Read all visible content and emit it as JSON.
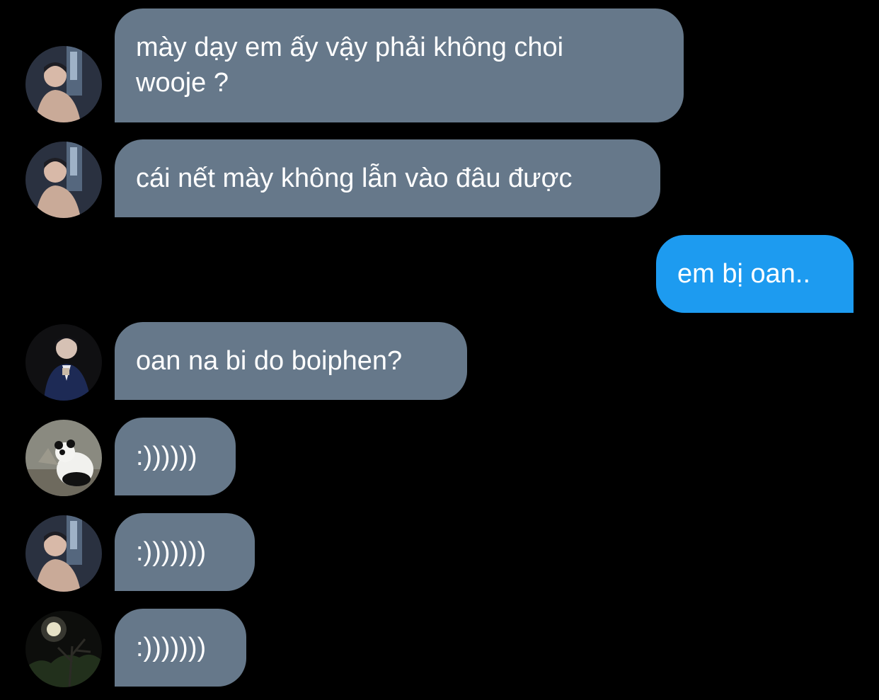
{
  "theme": {
    "background": "#000000",
    "incoming_bubble": "#66788a",
    "outgoing_bubble": "#1d9bf0",
    "text": "#ffffff"
  },
  "messages": [
    {
      "direction": "incoming",
      "sender_avatar": "avatar-person-grey-shirt",
      "text": "mày dạy em ấy vậy phải không choi\nwooje ?"
    },
    {
      "direction": "incoming",
      "sender_avatar": "avatar-person-grey-shirt",
      "text": "cái nết mày không lẫn vào đâu được"
    },
    {
      "direction": "outgoing",
      "text": "em bị oan.."
    },
    {
      "direction": "incoming",
      "sender_avatar": "avatar-person-suit",
      "text": "oan na bi do boiphen?"
    },
    {
      "direction": "incoming",
      "sender_avatar": "avatar-panda",
      "text": ":))))))"
    },
    {
      "direction": "incoming",
      "sender_avatar": "avatar-person-grey-shirt",
      "text": ":)))))))"
    },
    {
      "direction": "incoming",
      "sender_avatar": "avatar-night-moon",
      "text": ":)))))))"
    }
  ]
}
